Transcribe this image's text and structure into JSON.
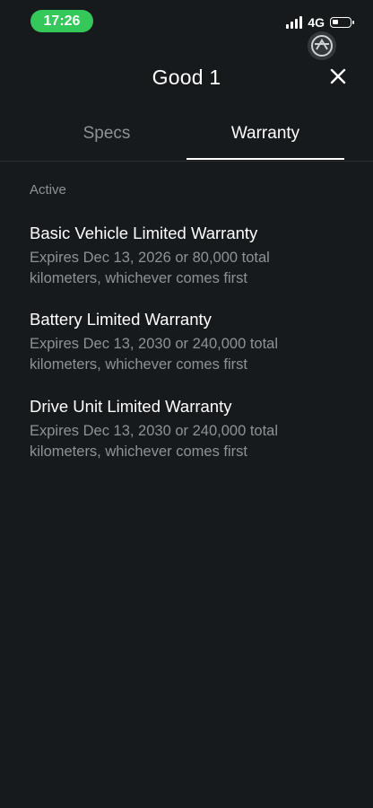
{
  "status_bar": {
    "time": "17:26",
    "network": "4G",
    "battery_level": 0.35
  },
  "header": {
    "title": "Good 1",
    "close_icon": "close-icon"
  },
  "tabs": [
    {
      "label": "Specs",
      "active": false
    },
    {
      "label": "Warranty",
      "active": true
    }
  ],
  "section": {
    "label": "Active"
  },
  "warranties": [
    {
      "title": "Basic Vehicle Limited Warranty",
      "description": "Expires Dec 13, 2026 or 80,000 total kilometers, whichever comes first"
    },
    {
      "title": "Battery Limited Warranty",
      "description": "Expires Dec 13, 2030 or 240,000 total kilometers, whichever comes first"
    },
    {
      "title": "Drive Unit Limited Warranty",
      "description": "Expires Dec 13, 2030 or 240,000 total kilometers, whichever comes first"
    }
  ],
  "colors": {
    "background": "#171a1d",
    "primary_text": "#ffffff",
    "secondary_text": "#8e9296",
    "time_pill": "#34c759"
  }
}
